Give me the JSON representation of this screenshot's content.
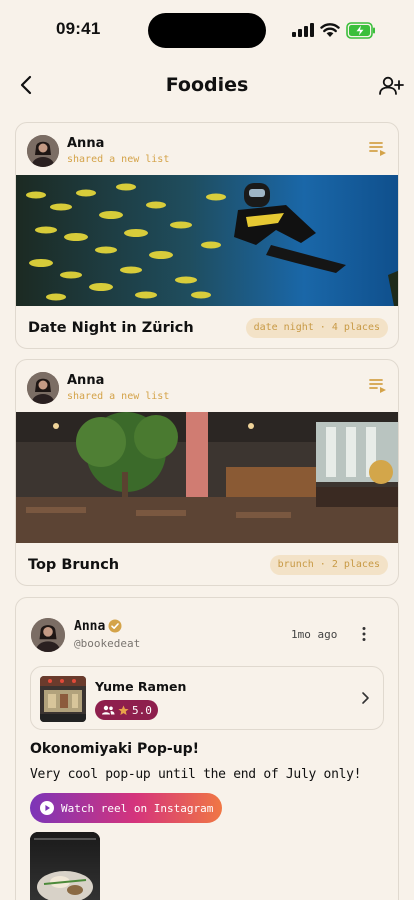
{
  "status_bar": {
    "time": "09:41"
  },
  "nav": {
    "title": "Foodies"
  },
  "lists": [
    {
      "user": "Anna",
      "action": "shared a new list",
      "title": "Date Night in Zürich",
      "tag": "date night · 4 places"
    },
    {
      "user": "Anna",
      "action": "shared a new list",
      "title": "Top Brunch",
      "tag": "brunch · 2 places"
    }
  ],
  "post": {
    "user": "Anna",
    "handle": "@bookedeat",
    "time_ago": "1mo ago",
    "place": {
      "name": "Yume Ramen",
      "rating": "5.0"
    },
    "title": "Okonomiyaki Pop-up!",
    "text": "Very cool pop-up until the end of July only!",
    "reel_label": "Watch reel on Instagram"
  },
  "colors": {
    "background": "#f8f2ea",
    "accent": "#d4a349",
    "rating_badge": "#8e1f4d"
  }
}
